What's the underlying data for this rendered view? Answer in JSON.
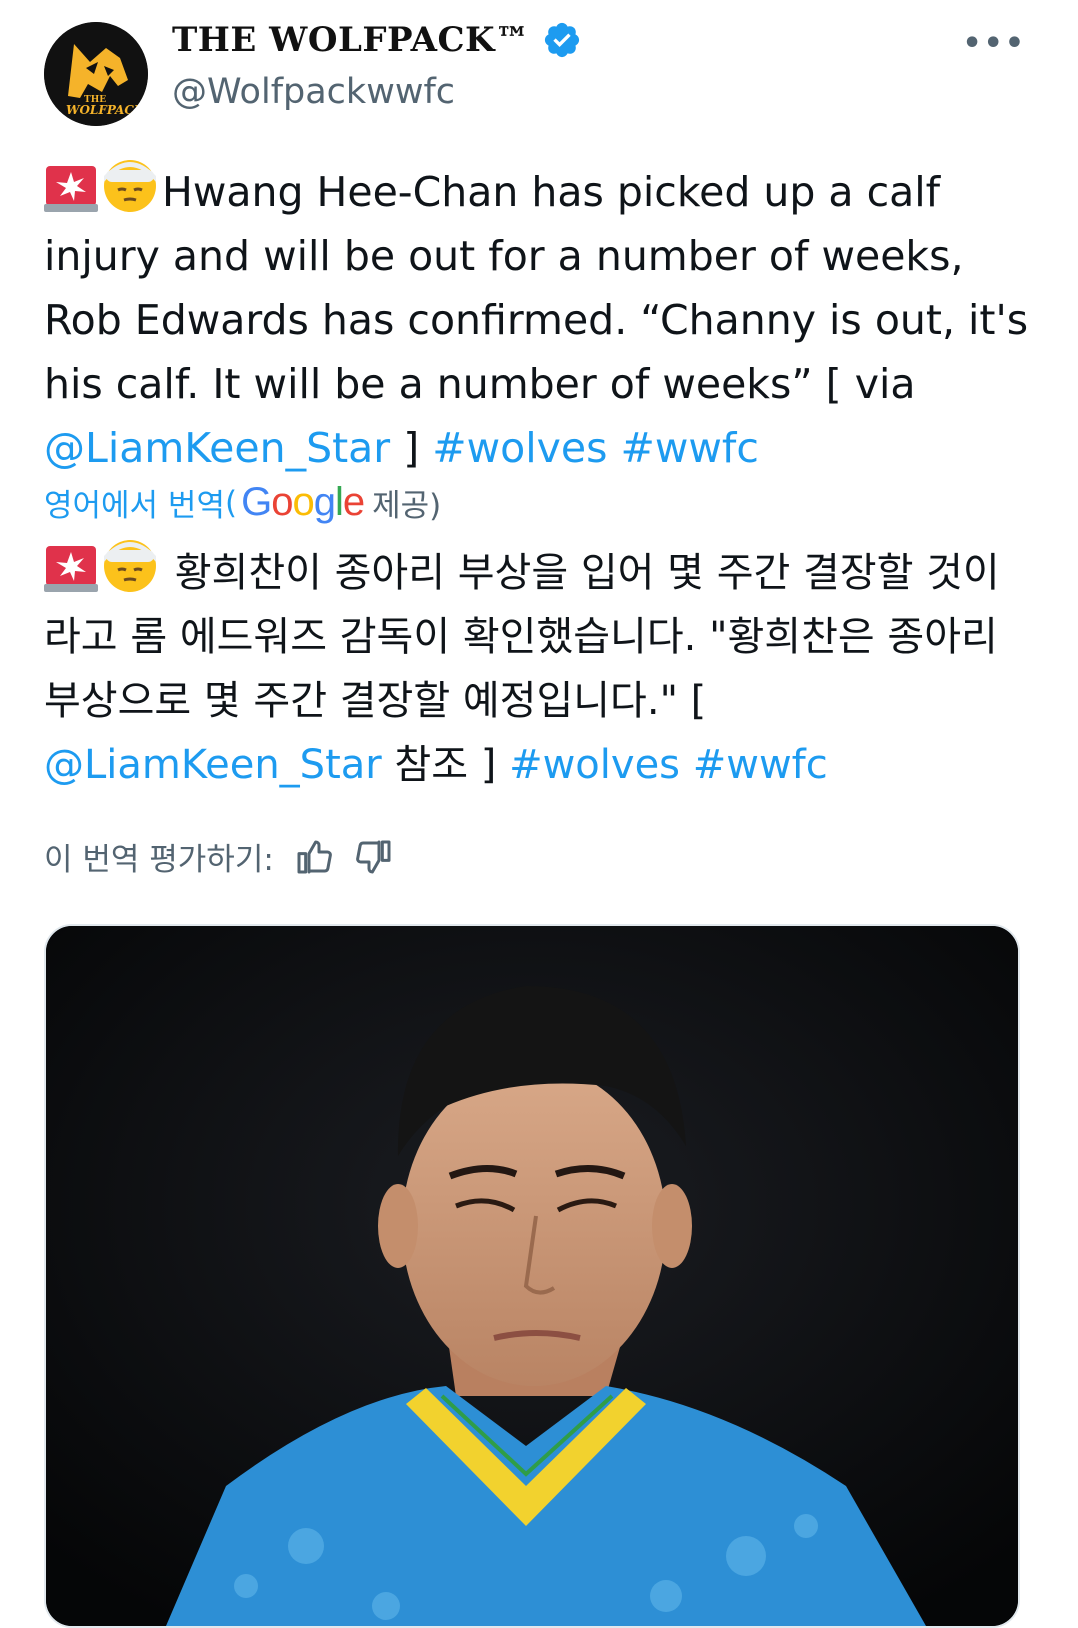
{
  "account": {
    "display_name": "THE WOLFPACK™",
    "handle": "@Wolfpackwwfc",
    "avatar_text_top": "THE",
    "avatar_text_bottom": "WOLFPACK"
  },
  "tweet": {
    "text_main": "Hwang Hee-Chan has picked up a calf injury and will be out for a number of weeks, Rob Edwards has confirmed. “Channy is out, it's his calf. It will be a number of weeks” [ via ",
    "mention": "@LiamKeen_Star",
    "text_after_mention": " ] ",
    "hashtag_1": "#wolves",
    "hashtag_2": "#wwfc"
  },
  "translation": {
    "label": "영어에서 번역",
    "open_paren": "(",
    "provider_google": "Google",
    "provided": "제공)",
    "text_main": "황희찬이 종아리 부상을 입어 몇 주간 결장할 것이라고 롬 에드워즈 감독이 확인했습니다. \"황희찬은 종아리 부상으로 몇 주간 결장할 예정입니다.\" [ ",
    "mention": "@LiamKeen_Star",
    "text_after_mention": " 참조 ] ",
    "hashtag_1": "#wolves",
    "hashtag_2": "#wwfc",
    "rate_label": "이 번역 평가하기:"
  },
  "icons": {
    "verified": "verified-badge-icon",
    "more": "more-options-icon",
    "siren": "rotating-light-emoji",
    "bandage": "face-with-head-bandage-emoji",
    "thumbs_up": "thumbs-up-icon",
    "thumbs_down": "thumbs-down-icon"
  },
  "colors": {
    "link": "#1d9bf0",
    "muted": "#536471",
    "text": "#0f1419",
    "avatar_bg": "#111111",
    "avatar_fg": "#f5b32a",
    "jersey_blue": "#2d8fd5",
    "jersey_yellow": "#f2d22e"
  }
}
